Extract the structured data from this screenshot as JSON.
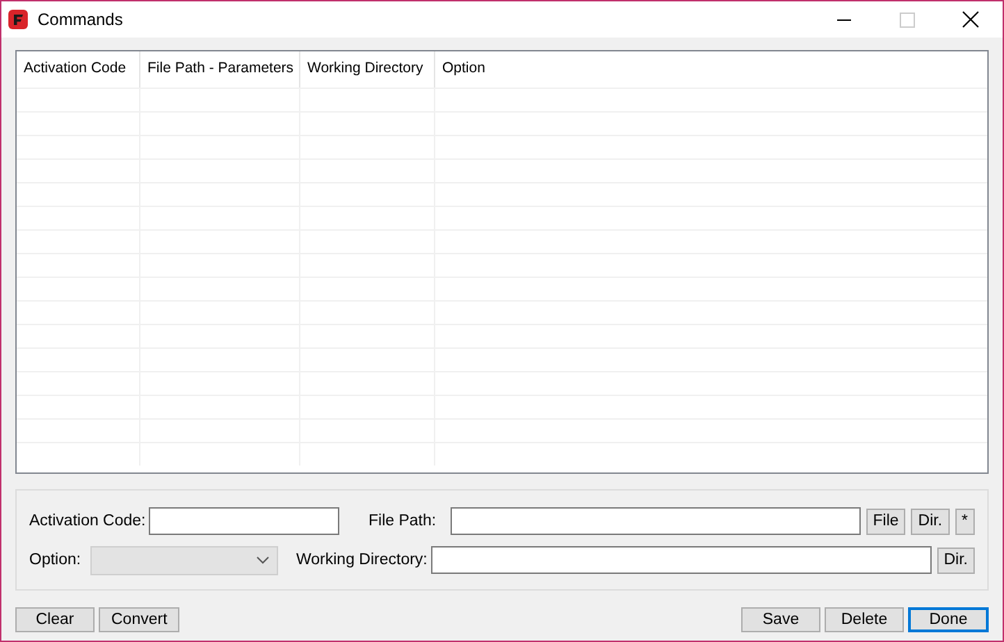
{
  "window": {
    "title": "Commands",
    "maximize_disabled": true
  },
  "table": {
    "columns": [
      "Activation Code",
      "File Path - Parameters",
      "Working Directory",
      "Option"
    ]
  },
  "form": {
    "activation_code": {
      "label": "Activation Code:"
    },
    "file_path": {
      "label": "File Path:",
      "buttons": [
        "File",
        "Dir.",
        "*"
      ]
    },
    "option": {
      "label": "Option:",
      "disabled": true
    },
    "working_directory": {
      "label": "Working Directory:",
      "buttons": [
        "Dir."
      ]
    }
  },
  "left_buttons": [
    {
      "label": "Clear",
      "default": false
    },
    {
      "label": "Convert",
      "default": false
    }
  ],
  "right_buttons": [
    {
      "label": "Save",
      "default": false
    },
    {
      "label": "Delete",
      "default": false
    },
    {
      "label": "Done",
      "default": true
    }
  ]
}
